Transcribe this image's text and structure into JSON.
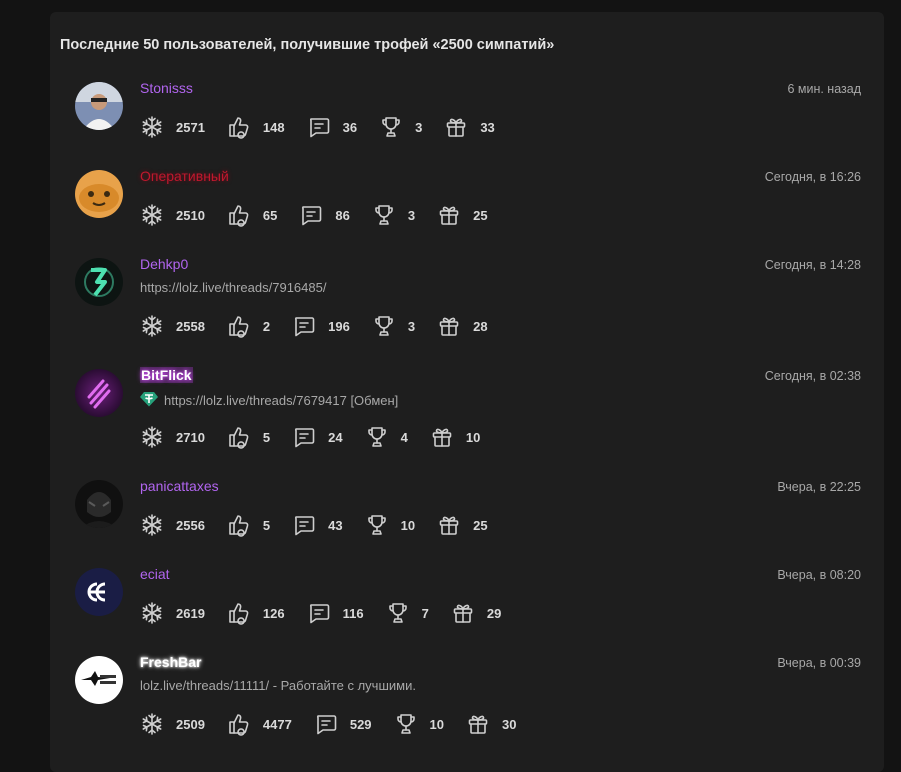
{
  "title": "Последние 50 пользователей, получившие трофей «2500 симпатий»",
  "colors": {
    "purple": "#b165ef",
    "red": "#c0182e",
    "white": "#ffffff"
  },
  "stat_icons": [
    "snowflake-icon",
    "like-icon",
    "message-icon",
    "trophy-icon",
    "gift-icon"
  ],
  "users": [
    {
      "name": "Stonisss",
      "time": "6 мин. назад",
      "status": "",
      "stats": [
        "2571",
        "148",
        "36",
        "3",
        "33"
      ]
    },
    {
      "name": "Оперативный",
      "time": "Сегодня, в 16:26",
      "status": "",
      "stats": [
        "2510",
        "65",
        "86",
        "3",
        "25"
      ]
    },
    {
      "name": "Dehkp0",
      "time": "Сегодня, в 14:28",
      "status": "https://lolz.live/threads/7916485/",
      "stats": [
        "2558",
        "2",
        "196",
        "3",
        "28"
      ]
    },
    {
      "name": "BitFlick",
      "time": "Сегодня, в 02:38",
      "status": "https://lolz.live/threads/7679417 [Обмен]",
      "stats": [
        "2710",
        "5",
        "24",
        "4",
        "10"
      ]
    },
    {
      "name": "panicattaxes",
      "time": "Вчера, в 22:25",
      "status": "",
      "stats": [
        "2556",
        "5",
        "43",
        "10",
        "25"
      ]
    },
    {
      "name": "eciat",
      "time": "Вчера, в 08:20",
      "status": "",
      "stats": [
        "2619",
        "126",
        "116",
        "7",
        "29"
      ]
    },
    {
      "name": "FreshBar",
      "time": "Вчера, в 00:39",
      "status": "lolz.live/threads/11111/ - Работайте с лучшими.",
      "stats": [
        "2509",
        "4477",
        "529",
        "10",
        "30"
      ]
    }
  ]
}
